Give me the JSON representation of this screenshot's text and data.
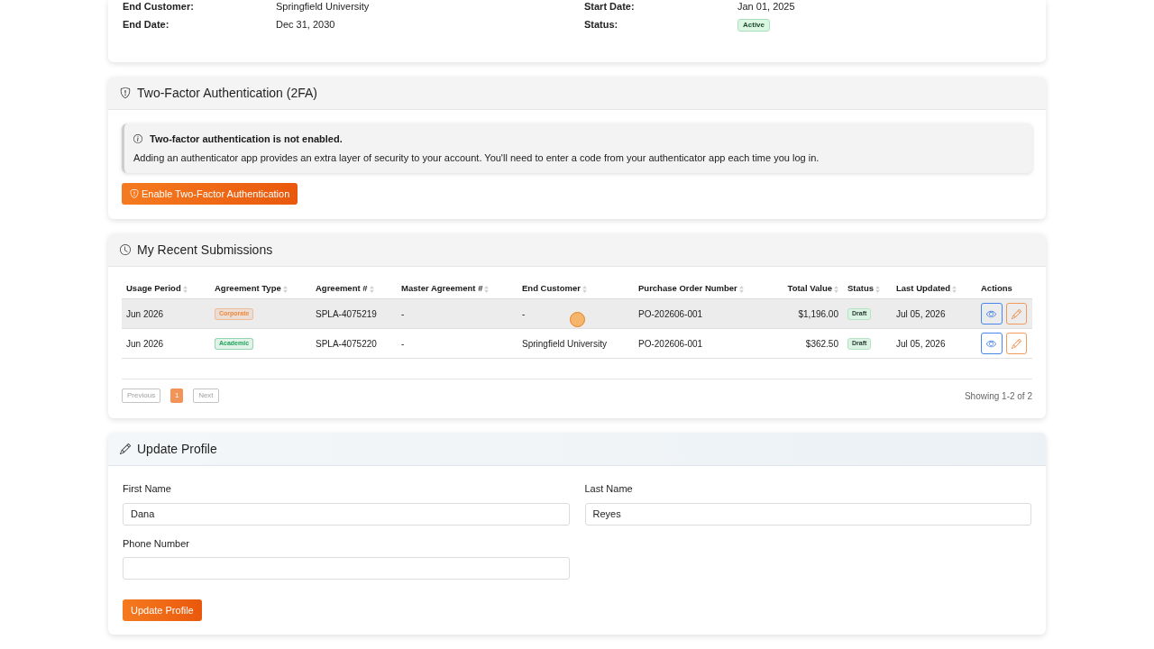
{
  "account_details": {
    "fields": [
      {
        "label": "End Customer:",
        "value": "Springfield University",
        "kind": "text"
      },
      {
        "label": "Start Date:",
        "value": "Jan 01, 2025",
        "kind": "text"
      },
      {
        "label": "End Date:",
        "value": "Dec 31, 2030",
        "kind": "text"
      },
      {
        "label": "Status:",
        "value": "Active",
        "kind": "badge"
      }
    ]
  },
  "two_factor": {
    "title": "Two-Factor Authentication (2FA)",
    "alert": {
      "heading": "Two-factor authentication is not enabled.",
      "message": "Adding an authenticator app provides an extra layer of security to your account. You'll need to enter a code from your authenticator app each time you log in."
    },
    "button": "Enable Two-Factor Authentication"
  },
  "submissions": {
    "title": "My Recent Submissions",
    "columns": [
      {
        "label": "Usage Period",
        "sortable": true
      },
      {
        "label": "Agreement Type",
        "sortable": true
      },
      {
        "label": "Agreement #",
        "sortable": true
      },
      {
        "label": "Master Agreement #",
        "sortable": true
      },
      {
        "label": "End Customer",
        "sortable": true
      },
      {
        "label": "Purchase Order Number",
        "sortable": true
      },
      {
        "label": "Total Value",
        "sortable": true
      },
      {
        "label": "Status",
        "sortable": true
      },
      {
        "label": "Last Updated",
        "sortable": true
      },
      {
        "label": "Actions",
        "sortable": false
      }
    ],
    "rows": [
      {
        "hovered": true,
        "usage_period": "Jun 2026",
        "agreement_type": {
          "label": "Corporate",
          "color": "#f0883e"
        },
        "agreement_number": "SPLA-4075219",
        "master_agreement_number": "-",
        "end_customer": "-",
        "purchase_order_number": "PO-202606-001",
        "total_value": "$1,196.00",
        "status": "Draft",
        "last_updated": "Jul 05, 2026"
      },
      {
        "hovered": false,
        "usage_period": "Jun 2026",
        "agreement_type": {
          "label": "Academic",
          "color": "#22a35a"
        },
        "agreement_number": "SPLA-4075220",
        "master_agreement_number": "-",
        "end_customer": "Springfield University",
        "purchase_order_number": "PO-202606-001",
        "total_value": "$362.50",
        "status": "Draft",
        "last_updated": "Jul 05, 2026"
      }
    ],
    "pagination": {
      "previous": {
        "label": "Previous",
        "disabled": true
      },
      "pages": [
        {
          "label": "1",
          "selected": true
        }
      ],
      "next": {
        "label": "Next",
        "disabled": true
      },
      "summary": "Showing 1-2 of 2"
    }
  },
  "update_profile": {
    "title": "Update Profile",
    "fields": [
      {
        "label": "First Name",
        "value": "Dana"
      },
      {
        "label": "Last Name",
        "value": "Reyes"
      },
      {
        "label": "Phone Number"
      }
    ],
    "button": "Update Profile"
  }
}
